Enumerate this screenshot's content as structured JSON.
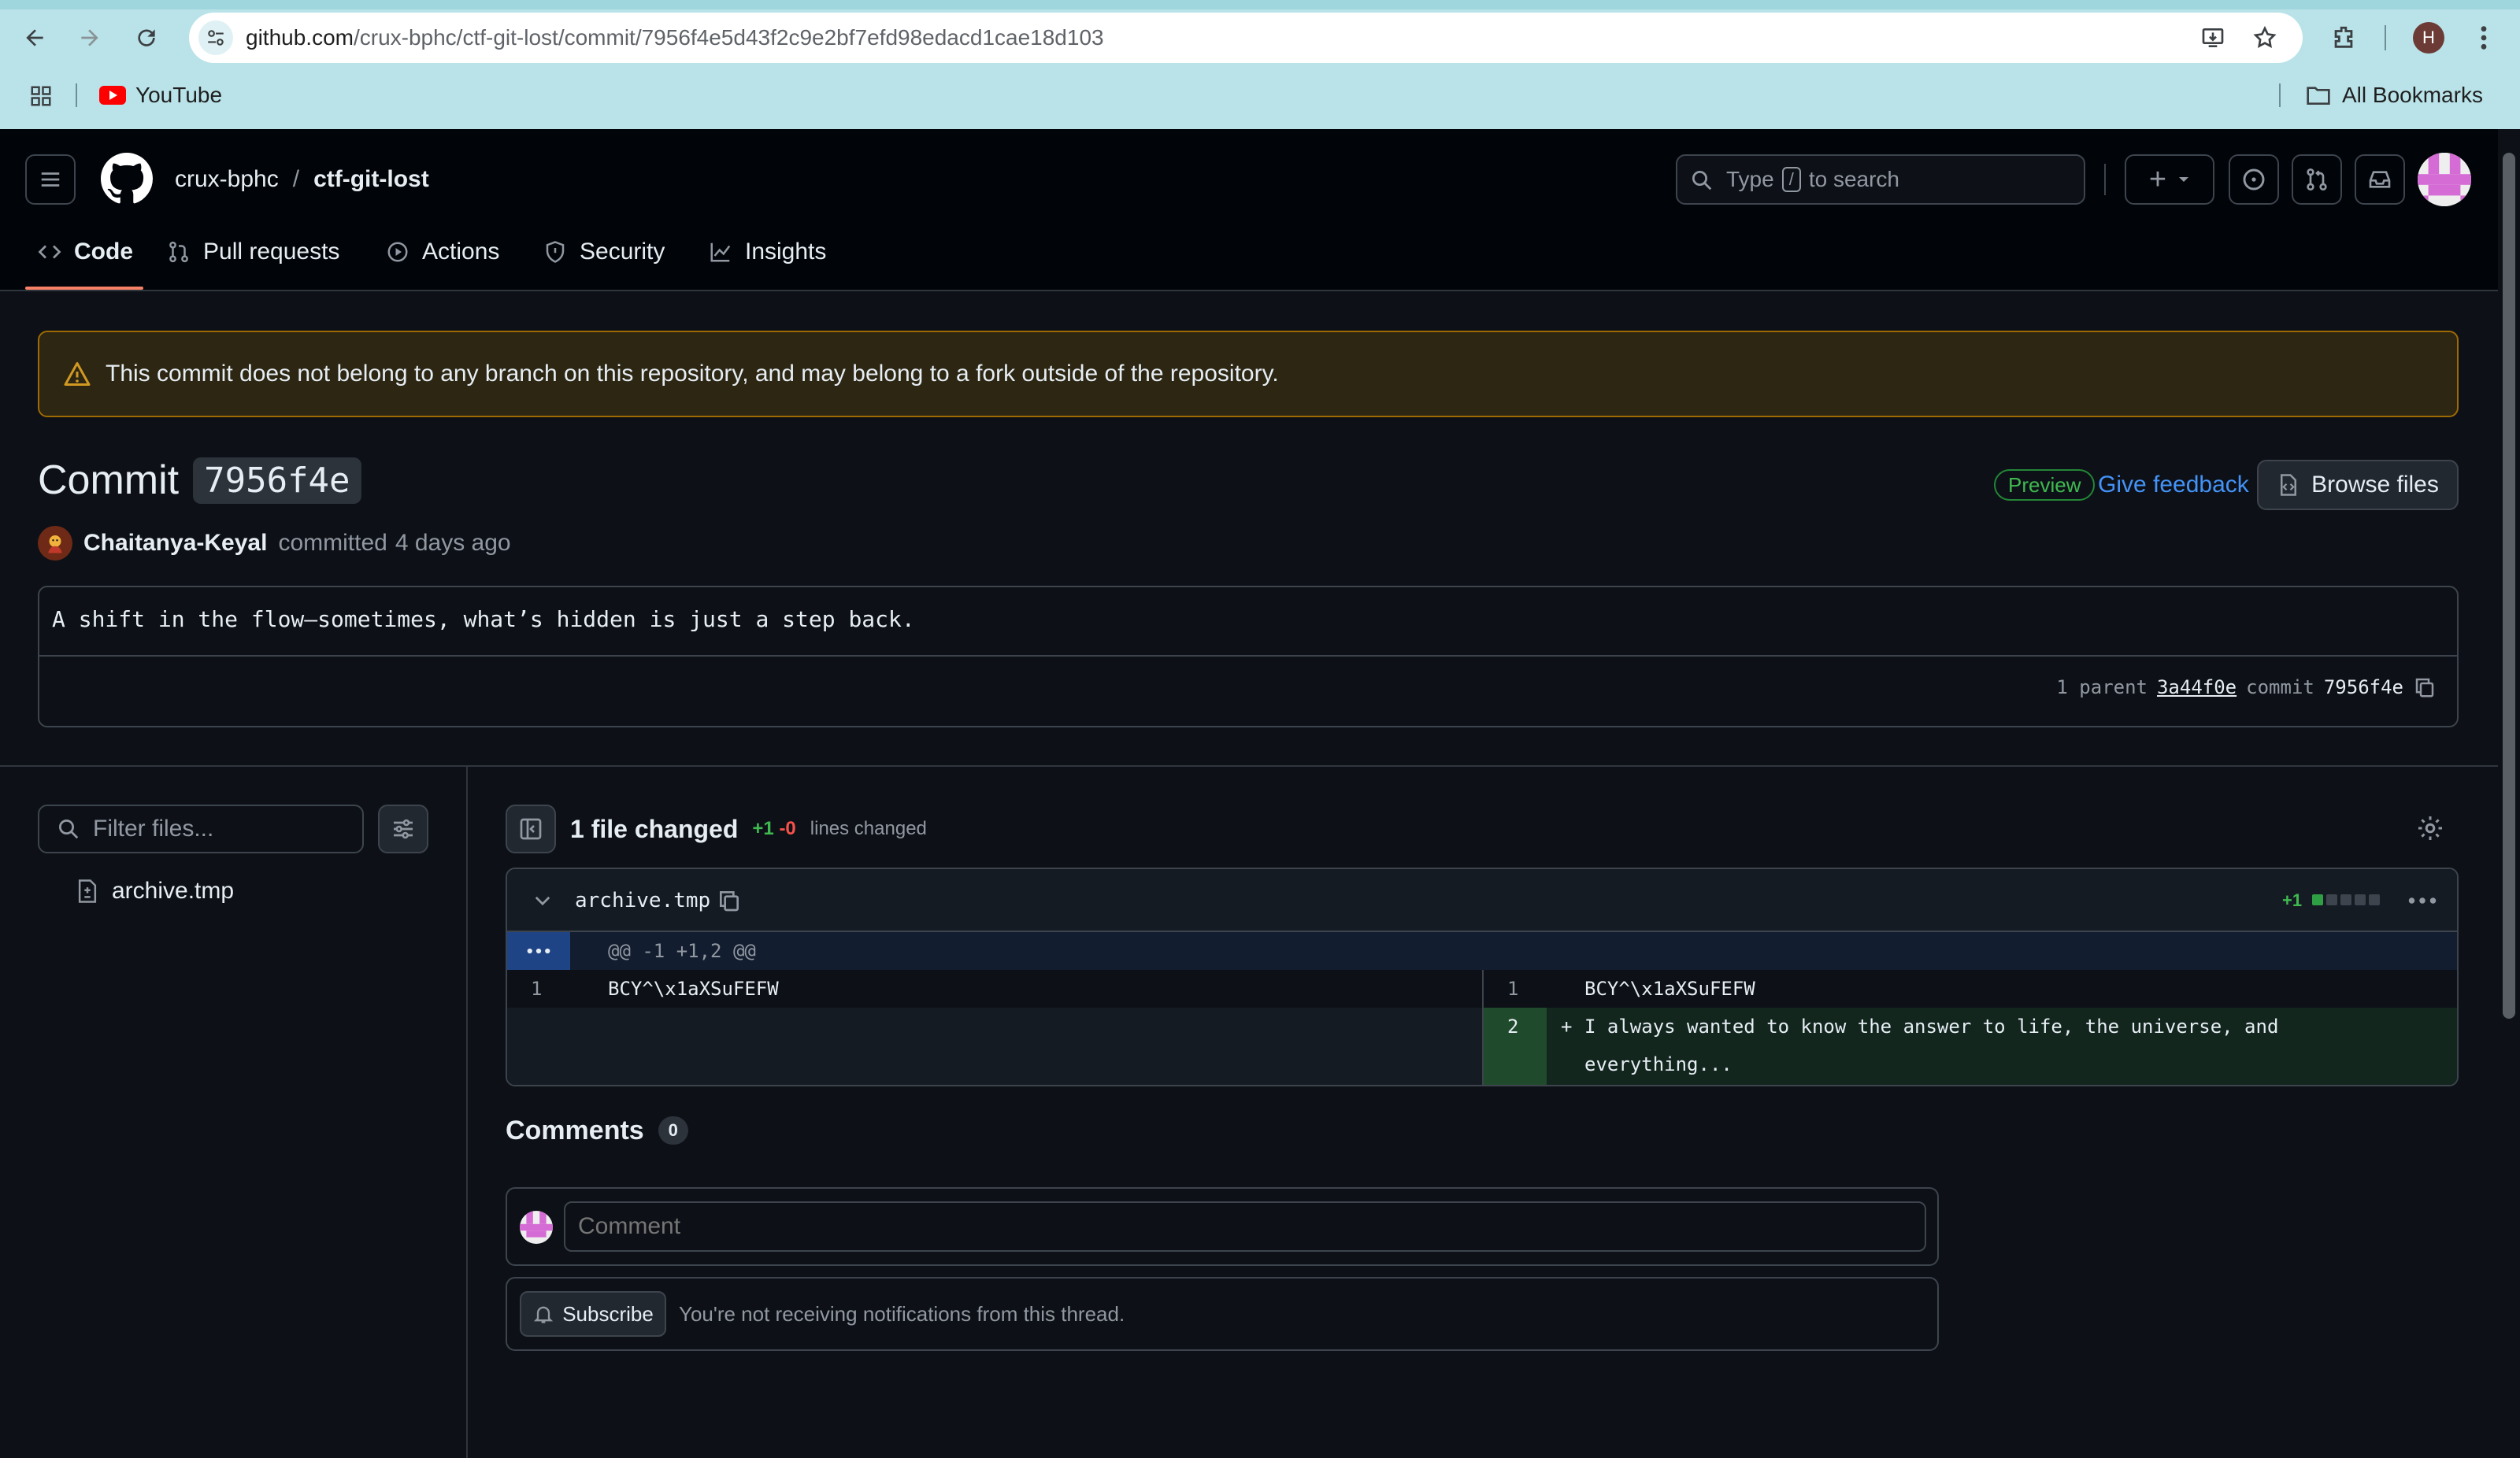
{
  "browser": {
    "url_domain": "github.com",
    "url_path": "/crux-bphc/ctf-git-lost/commit/7956f4e5d43f2c9e2bf7efd98edacd1cae18d103",
    "profile_initial": "H",
    "bookmarks": [
      {
        "label": "YouTube"
      }
    ],
    "all_bookmarks_label": "All Bookmarks"
  },
  "header": {
    "owner": "crux-bphc",
    "separator": "/",
    "repo": "ctf-git-lost",
    "search_prefix": "Type",
    "search_key": "/",
    "search_suffix": "to search",
    "new_button_label": "+"
  },
  "tabs": [
    {
      "label": "Code",
      "icon": "code-icon",
      "active": true
    },
    {
      "label": "Pull requests",
      "icon": "pull-request-icon"
    },
    {
      "label": "Actions",
      "icon": "play-icon"
    },
    {
      "label": "Security",
      "icon": "shield-icon"
    },
    {
      "label": "Insights",
      "icon": "graph-icon"
    }
  ],
  "warning": {
    "text": "This commit does not belong to any branch on this repository, and may belong to a fork outside of the repository."
  },
  "commit": {
    "title_prefix": "Commit",
    "short_sha": "7956f4e",
    "preview_label": "Preview",
    "feedback_label": "Give feedback",
    "browse_label": "Browse files",
    "author": "Chaitanya-Keyal",
    "action": "committed",
    "time": "4 days ago",
    "message": "A shift in the flow—sometimes, what’s hidden is just a step back.",
    "parent_label": "1 parent",
    "parent_sha": "3a44f0e",
    "commit_label": "commit",
    "commit_sha": "7956f4e"
  },
  "sidebar": {
    "filter_placeholder": "Filter files...",
    "files": [
      {
        "name": "archive.tmp"
      }
    ]
  },
  "diff": {
    "summary": "1 file changed",
    "added": "+1",
    "removed": "-0",
    "lines_label": "lines changed",
    "file": {
      "name": "archive.tmp",
      "added_badge": "+1",
      "hunk": "@@ -1 +1,2 @@",
      "left": [
        {
          "no": "1",
          "text": "BCY^\\x1aXSuFEFW"
        }
      ],
      "right": [
        {
          "no": "1",
          "text": "BCY^\\x1aXSuFEFW",
          "type": "context"
        },
        {
          "no": "2",
          "marker": "+",
          "text_line1": "I always wanted to know the answer to life, the universe, and",
          "text_line2": "everything...",
          "type": "add"
        }
      ]
    }
  },
  "comments": {
    "title": "Comments",
    "count": "0",
    "placeholder": "Comment",
    "subscribe_label": "Subscribe",
    "subscribe_text": "You're not receiving notifications from this thread."
  },
  "colors": {
    "accent_blue": "#4493f8",
    "add_green": "#3fb950",
    "remove_red": "#f85149",
    "warning_border": "#9e6a03"
  }
}
